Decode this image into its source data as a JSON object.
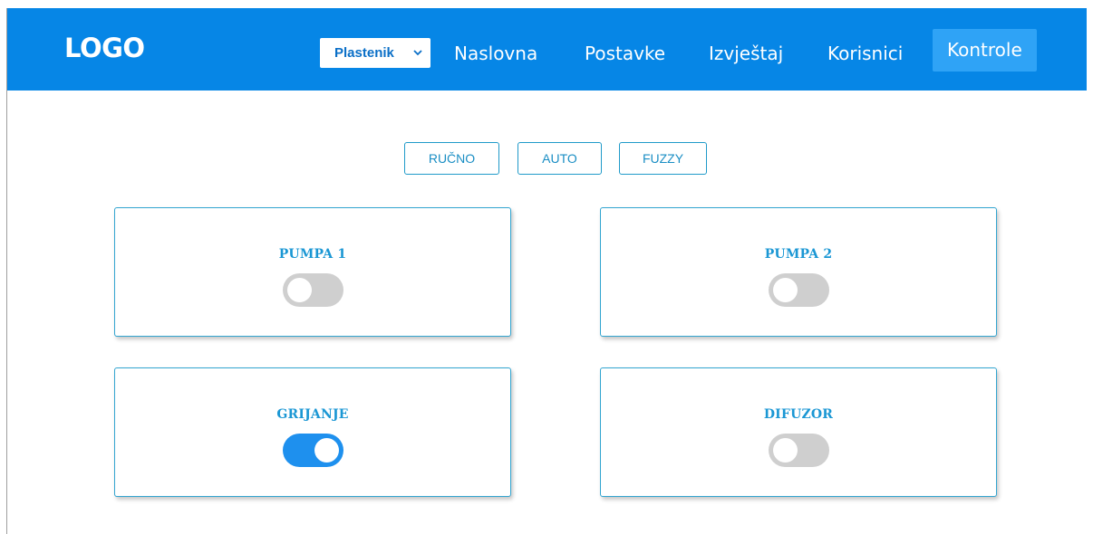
{
  "header": {
    "logo": "LOGO",
    "select": {
      "value": "Plastenik",
      "icon": "chevron-down-icon"
    },
    "nav": [
      {
        "label": "Naslovna",
        "active": false
      },
      {
        "label": "Postavke",
        "active": false
      },
      {
        "label": "Izvještaj",
        "active": false
      },
      {
        "label": "Korisnici",
        "active": false
      },
      {
        "label": "Kontrole",
        "active": true
      }
    ]
  },
  "modes": [
    {
      "label": "RUČNO"
    },
    {
      "label": "AUTO"
    },
    {
      "label": "FUZZY"
    }
  ],
  "controls": [
    {
      "title": "PUMPA 1",
      "on": false
    },
    {
      "title": "PUMPA 2",
      "on": false
    },
    {
      "title": "GRIJANJE",
      "on": true
    },
    {
      "title": "DIFUZOR",
      "on": false
    }
  ],
  "colors": {
    "navbar": "#0686e6",
    "active_nav": "#2fa3f6",
    "accent": "#1b97d4",
    "toggle_on": "#1e90ee",
    "toggle_off": "#cfcfcf"
  }
}
